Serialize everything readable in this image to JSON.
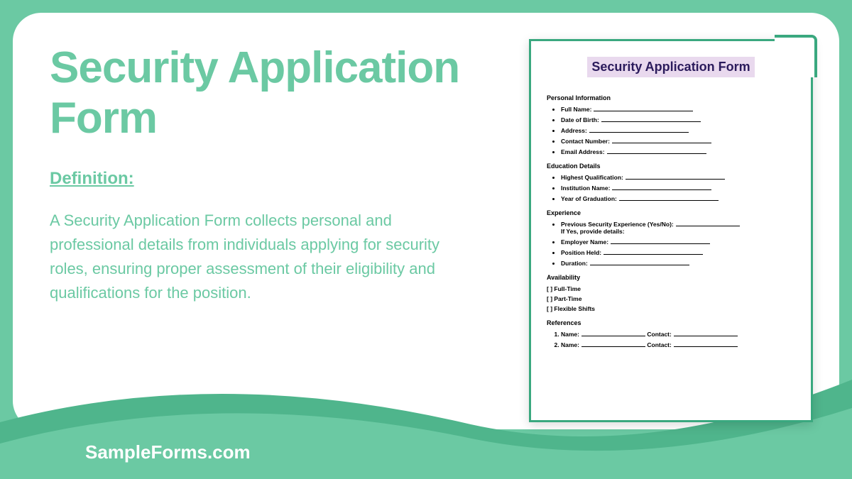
{
  "main": {
    "title": "Security Application Form",
    "definition_label": "Definition:",
    "definition_text": "A Security Application Form collects personal and professional details from individuals applying for security roles, ensuring proper assessment of their eligibility and qualifications for the position."
  },
  "footer": {
    "brand": "SampleForms.com"
  },
  "form_preview": {
    "title": "Security Application Form",
    "sections": {
      "personal": {
        "heading": "Personal Information",
        "fields": [
          "Full Name:",
          "Date of Birth:",
          "Address:",
          "Contact Number:",
          "Email Address:"
        ]
      },
      "education": {
        "heading": "Education Details",
        "fields": [
          "Highest Qualification:",
          "Institution Name:",
          "Year of Graduation:"
        ]
      },
      "experience": {
        "heading": "Experience",
        "line1": "Previous Security Experience (Yes/No):",
        "line1b": "If Yes, provide details:",
        "fields": [
          "Employer Name:",
          "Position Held:",
          "Duration:"
        ]
      },
      "availability": {
        "heading": "Availability",
        "options": [
          "[ ] Full-Time",
          "[ ] Part-Time",
          "[ ] Flexible Shifts"
        ]
      },
      "references": {
        "heading": "References",
        "name_label": "Name:",
        "contact_label": "Contact:"
      }
    }
  }
}
